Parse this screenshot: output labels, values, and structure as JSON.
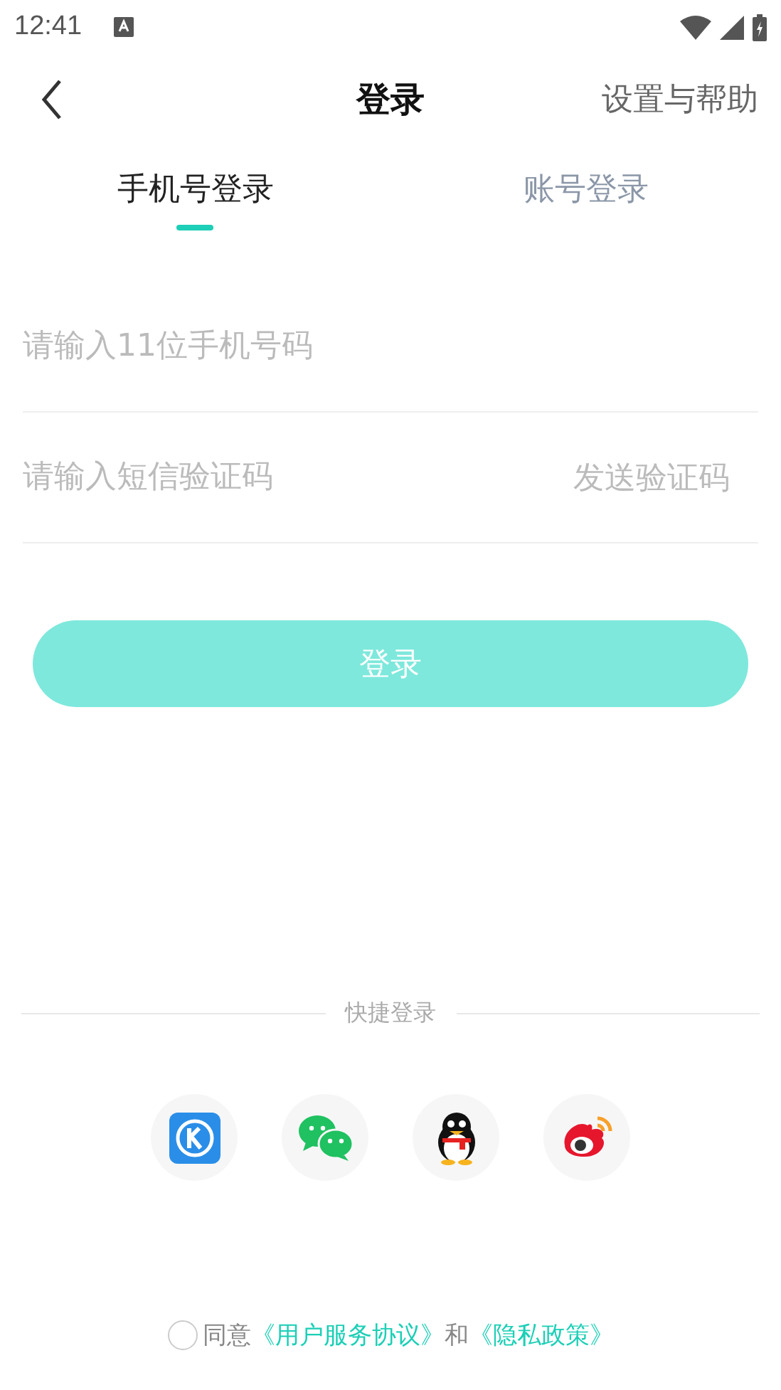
{
  "status_bar": {
    "time": "12:41"
  },
  "header": {
    "title": "登录",
    "action": "设置与帮助"
  },
  "tabs": [
    {
      "label": "手机号登录",
      "selected": true
    },
    {
      "label": "账号登录",
      "selected": false
    }
  ],
  "fields": [
    {
      "placeholder": "请输入11位手机号码"
    },
    {
      "placeholder": "请输入短信验证码",
      "action": "发送验证码"
    }
  ],
  "login_button": {
    "label": "登录",
    "disabled": true
  },
  "quick_login": {
    "label": "快捷登录",
    "options": [
      {
        "kind": "kugou"
      },
      {
        "kind": "wechat"
      },
      {
        "kind": "qq"
      },
      {
        "kind": "weibo"
      }
    ]
  },
  "agreement": {
    "checked": false,
    "prefix": "同意",
    "link_1": "《用户服务协议》",
    "joiner": "和",
    "link_2": "《隐私政策》"
  }
}
